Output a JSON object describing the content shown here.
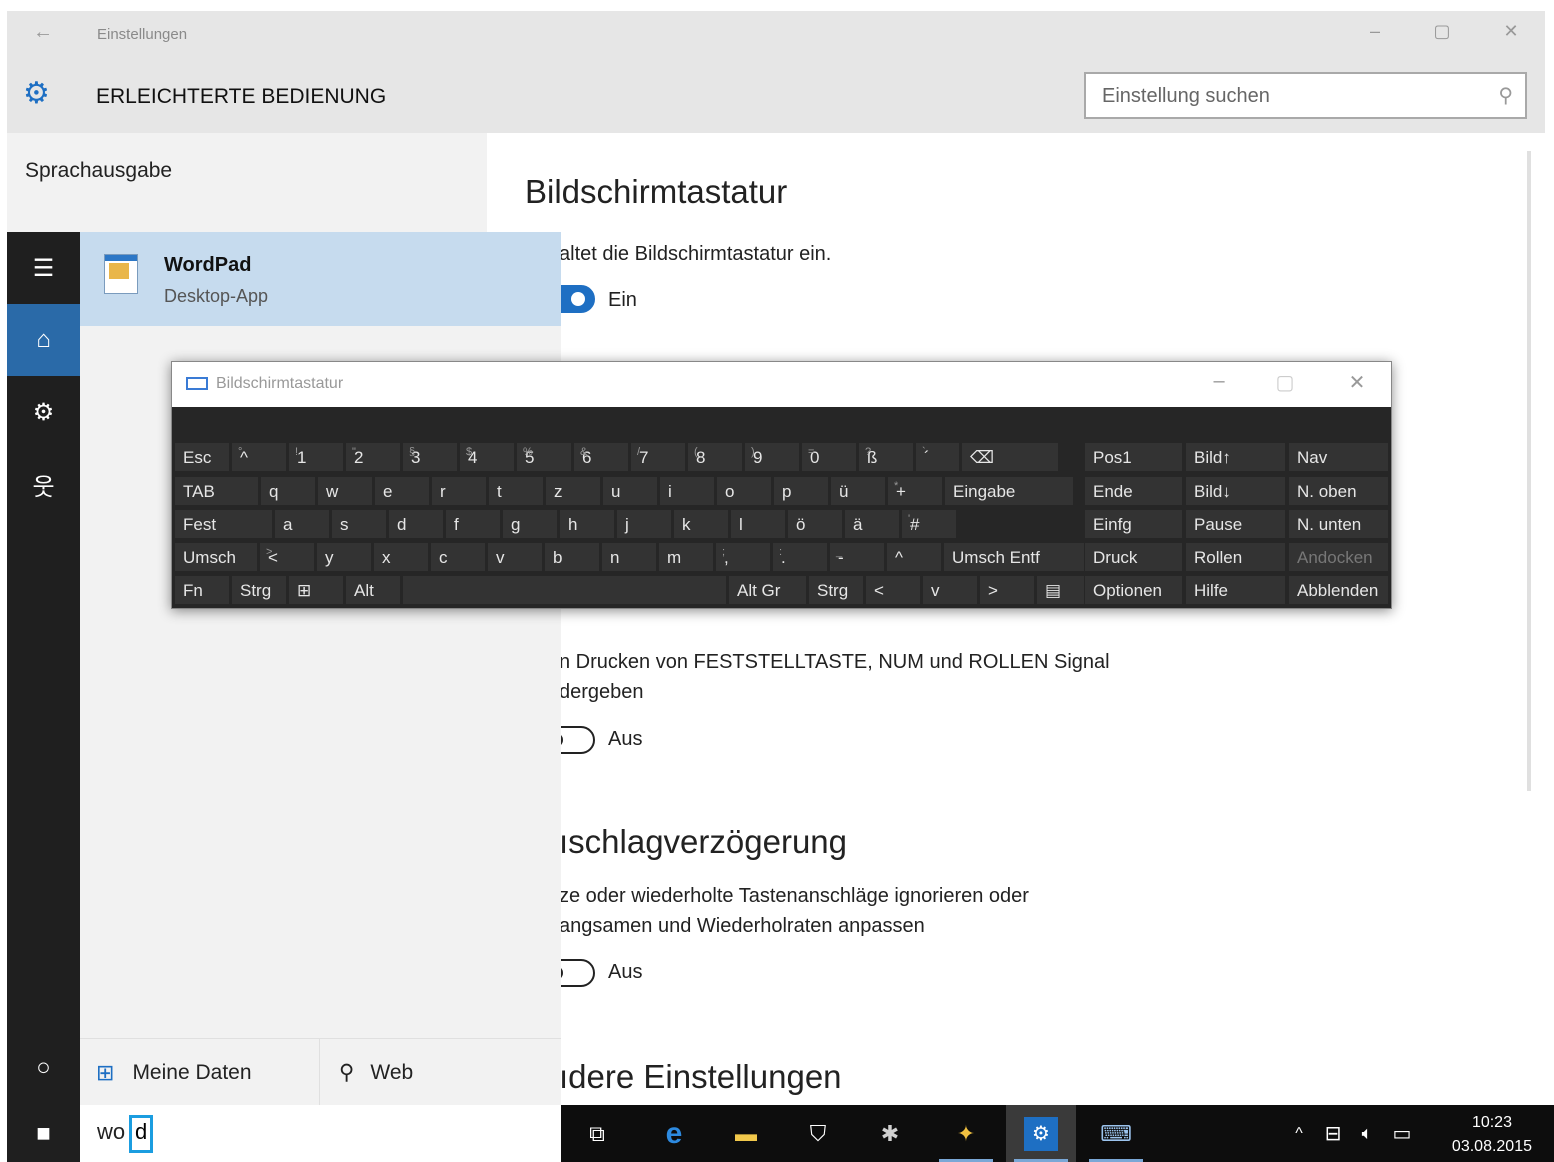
{
  "settings": {
    "window_title": "Einstellungen",
    "section_title": "ERLEICHTERTE BEDIENUNG",
    "search_placeholder": "Einstellung suchen",
    "nav_item": "Sprachausgabe",
    "content": {
      "title": "Bildschirmtastatur",
      "desc1": "altet die Bildschirmtastatur ein.",
      "toggle1_label": "Ein",
      "desc2a": "n Drucken von FESTSTELLTASTE, NUM und ROLLEN Signal",
      "desc2b": "dergeben",
      "toggle2_label": "Aus",
      "title2": "ıschlagverzögerung",
      "desc3a": "ze oder wiederholte Tastenanschläge ignorieren oder",
      "desc3b": "angsamen und Wiederholraten anpassen",
      "toggle3_label": "Aus",
      "title3": "ıdere Einstellungen"
    }
  },
  "start_menu": {
    "result_name": "WordPad",
    "result_type": "Desktop-App",
    "tab_my_data": "Meine Daten",
    "tab_web": "Web",
    "search_text": "wo",
    "search_caret_char": "d"
  },
  "taskbar": {
    "time": "10:23",
    "date": "03.08.2015"
  },
  "osk": {
    "title": "Bildschirmtastatur",
    "rows": [
      [
        {
          "label": "Esc"
        },
        {
          "label": "^",
          "sub": "°"
        },
        {
          "label": "1",
          "sub": "!"
        },
        {
          "label": "2",
          "sub": "\""
        },
        {
          "label": "3",
          "sub": "§"
        },
        {
          "label": "4",
          "sub": "$"
        },
        {
          "label": "5",
          "sub": "%"
        },
        {
          "label": "6",
          "sub": "&"
        },
        {
          "label": "7",
          "sub": "/"
        },
        {
          "label": "8",
          "sub": "("
        },
        {
          "label": "9",
          "sub": ")"
        },
        {
          "label": "0",
          "sub": "="
        },
        {
          "label": "ß",
          "sub": "?"
        },
        {
          "label": "´",
          "sub": "`"
        },
        {
          "label": "⌫"
        }
      ],
      [
        {
          "label": "TAB"
        },
        {
          "label": "q"
        },
        {
          "label": "w"
        },
        {
          "label": "e"
        },
        {
          "label": "r"
        },
        {
          "label": "t"
        },
        {
          "label": "z"
        },
        {
          "label": "u"
        },
        {
          "label": "i"
        },
        {
          "label": "o"
        },
        {
          "label": "p"
        },
        {
          "label": "ü"
        },
        {
          "label": "+",
          "sub": "*"
        },
        {
          "label": "Eingabe"
        }
      ],
      [
        {
          "label": "Fest"
        },
        {
          "label": "a"
        },
        {
          "label": "s"
        },
        {
          "label": "d"
        },
        {
          "label": "f"
        },
        {
          "label": "g"
        },
        {
          "label": "h"
        },
        {
          "label": "j"
        },
        {
          "label": "k"
        },
        {
          "label": "l"
        },
        {
          "label": "ö"
        },
        {
          "label": "ä"
        },
        {
          "label": "#",
          "sub": "'"
        }
      ],
      [
        {
          "label": "Umsch"
        },
        {
          "label": "<",
          "sub": ">"
        },
        {
          "label": "y"
        },
        {
          "label": "x"
        },
        {
          "label": "c"
        },
        {
          "label": "v"
        },
        {
          "label": "b"
        },
        {
          "label": "n"
        },
        {
          "label": "m"
        },
        {
          "label": ",",
          "sub": ";"
        },
        {
          "label": ".",
          "sub": ":"
        },
        {
          "label": "-",
          "sub": "_"
        },
        {
          "label": "^"
        },
        {
          "label": "Umsch Entf"
        }
      ],
      [
        {
          "label": "Fn"
        },
        {
          "label": "Strg"
        },
        {
          "label": "⊞"
        },
        {
          "label": "Alt"
        },
        {
          "label": ""
        },
        {
          "label": "Alt Gr"
        },
        {
          "label": "Strg"
        },
        {
          "label": "<"
        },
        {
          "label": "v"
        },
        {
          "label": ">"
        },
        {
          "label": "▤"
        }
      ]
    ],
    "side_keys": [
      [
        "Pos1",
        "Bild↑",
        "Nav"
      ],
      [
        "Ende",
        "Bild↓",
        "N. oben"
      ],
      [
        "Einfg",
        "Pause",
        "N. unten"
      ],
      [
        "Druck",
        "Rollen",
        "Andocken"
      ],
      [
        "Optionen",
        "Hilfe",
        "Abblenden"
      ]
    ]
  }
}
